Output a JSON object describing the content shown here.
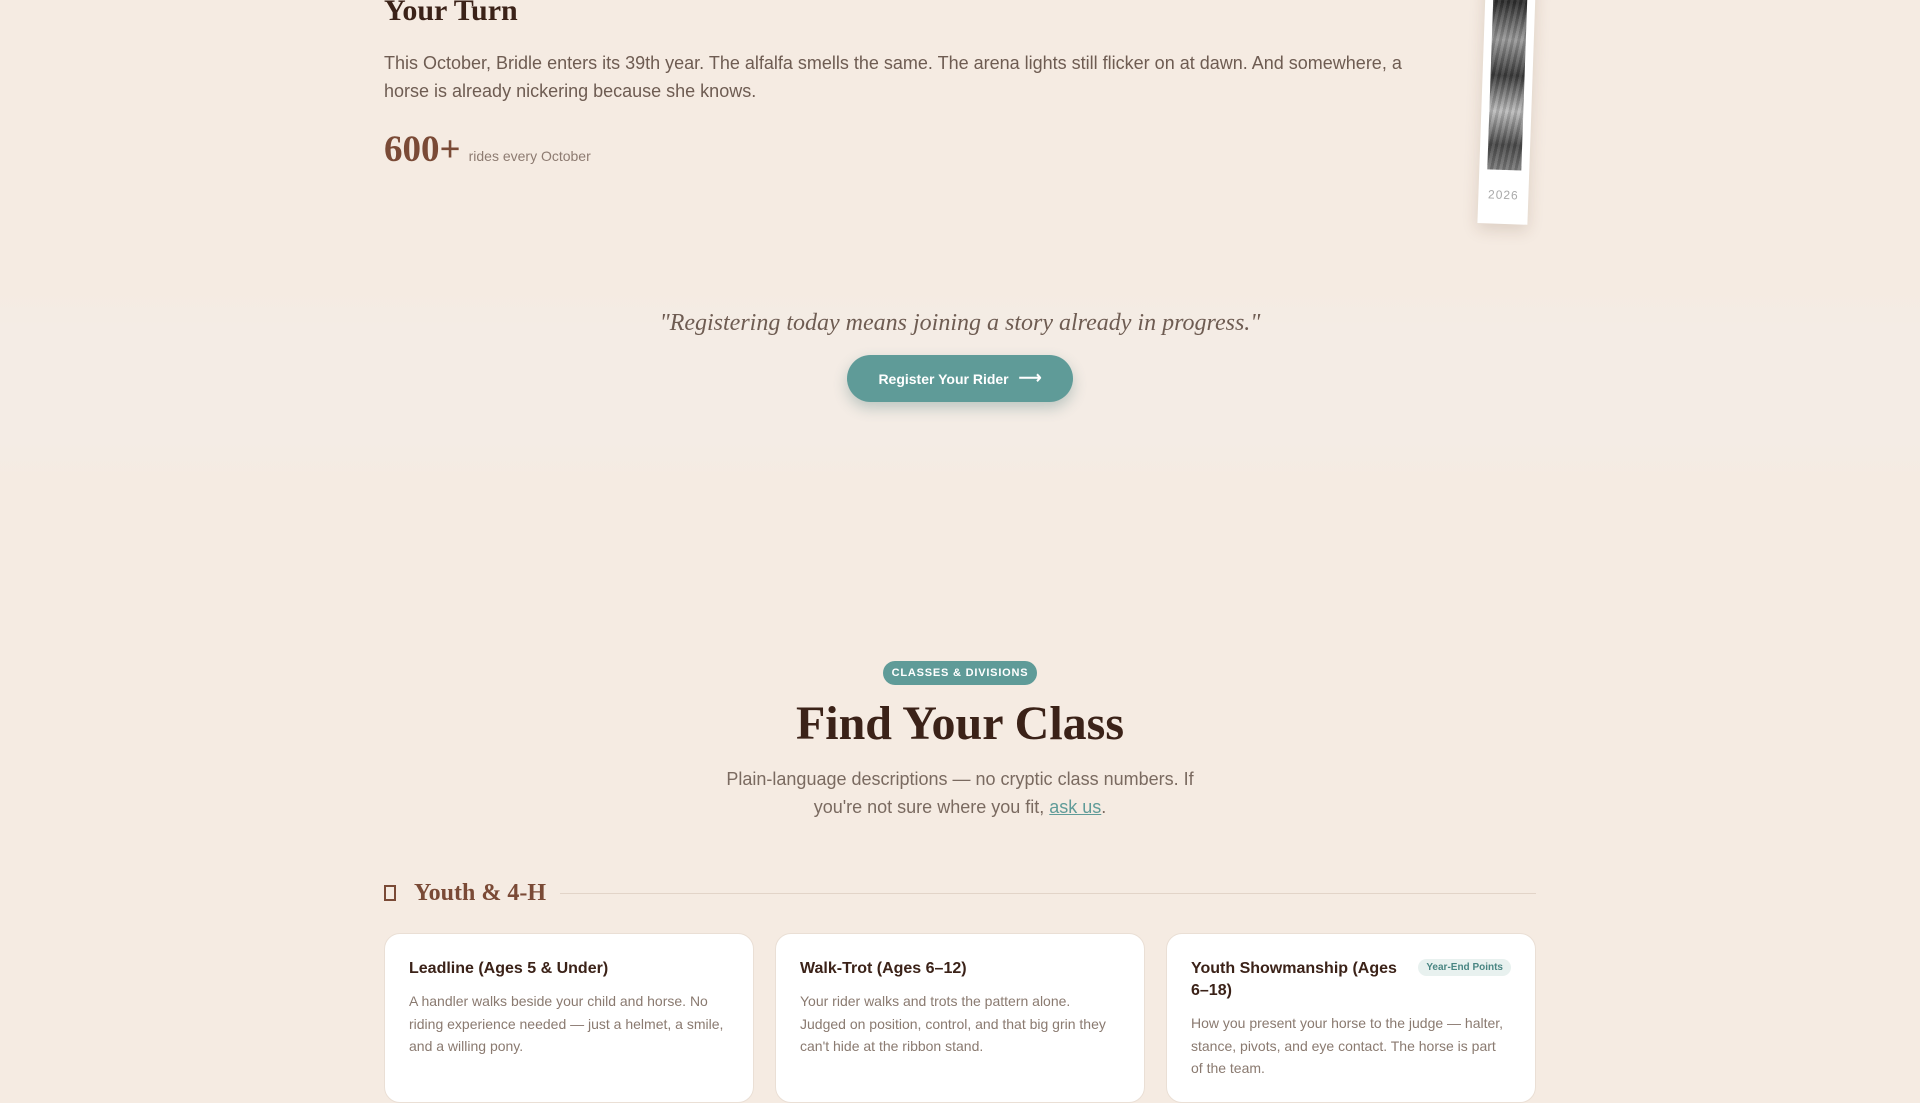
{
  "turn": {
    "title": "Your Turn",
    "body": "This October, Bridle enters its 39th year. The alfalfa smells the same. The arena lights still flicker on at dawn. And somewhere, a horse is already nickering because she knows.",
    "stat_value": "600+",
    "stat_label": "rides every October",
    "photo_year": "2026"
  },
  "cta_band": {
    "quote": "\"Registering today means joining a story already in progress.\"",
    "button_label": "Register Your Rider",
    "button_icon": "arrow-right-icon"
  },
  "classes": {
    "pill": "CLASSES & DIVISIONS",
    "title": "Find Your Class",
    "subtitle_before": "Plain-language descriptions — no cryptic class numbers. If you're not sure where you fit, ",
    "subtitle_link": "ask us",
    "subtitle_after": ".",
    "division": {
      "icon": "ribbon-icon",
      "title": "Youth & 4-H"
    },
    "cards": [
      {
        "title": "Leadline (Ages 5 & Under)",
        "badge": "",
        "description": "A handler walks beside your child and horse. No riding experience needed — just a helmet, a smile, and a willing pony."
      },
      {
        "title": "Walk-Trot (Ages 6–12)",
        "badge": "",
        "description": "Your rider walks and trots the pattern alone. Judged on position, control, and that big grin they can't hide at the ribbon stand."
      },
      {
        "title": "Youth Showmanship (Ages 6–18)",
        "badge": "Year-End Points",
        "description": "How you present your horse to the judge — halter, stance, pivots, and eye contact. The horse is part of the team."
      }
    ]
  },
  "colors": {
    "background": "#f5ebe2",
    "accent_teal": "#5f9b98",
    "heading_brown": "#3b2218",
    "stat_brown": "#7a4a36"
  }
}
